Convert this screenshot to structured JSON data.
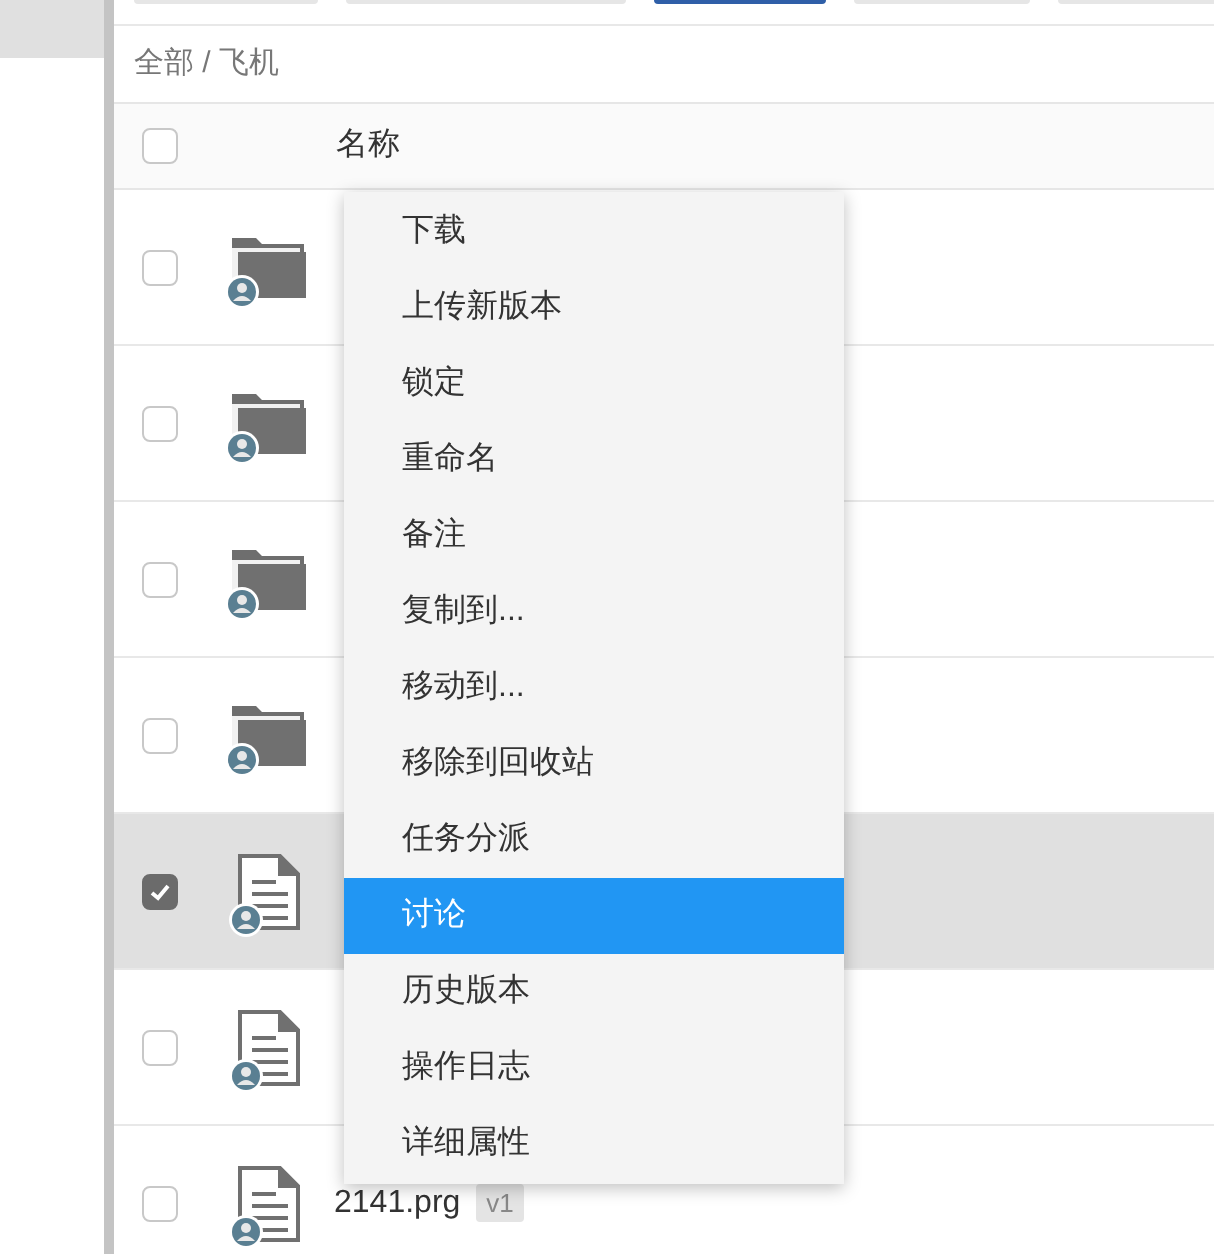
{
  "toolbar": [
    {
      "selected": false
    },
    {
      "selected": false
    },
    {
      "selected": true
    },
    {
      "selected": false
    },
    {
      "selected": false
    }
  ],
  "breadcrumb": "全部 / 飞机",
  "table": {
    "header": {
      "checked": false,
      "name": "名称"
    },
    "rows": [
      {
        "kind": "folder",
        "checked": false,
        "selected": false
      },
      {
        "kind": "folder",
        "checked": false,
        "selected": false
      },
      {
        "kind": "folder",
        "checked": false,
        "selected": false
      },
      {
        "kind": "folder",
        "checked": false,
        "selected": false
      },
      {
        "kind": "file",
        "checked": true,
        "selected": true
      },
      {
        "kind": "file",
        "checked": false,
        "selected": false
      },
      {
        "kind": "file",
        "checked": false,
        "selected": false,
        "name": "2141.prg",
        "version": "v1"
      }
    ]
  },
  "context_menu": [
    {
      "label": "下载",
      "selected": false
    },
    {
      "label": "上传新版本",
      "selected": false
    },
    {
      "label": "锁定",
      "selected": false
    },
    {
      "label": "重命名",
      "selected": false
    },
    {
      "label": "备注",
      "selected": false
    },
    {
      "label": "复制到...",
      "selected": false
    },
    {
      "label": "移动到...",
      "selected": false
    },
    {
      "label": "移除到回收站",
      "selected": false
    },
    {
      "label": "任务分派",
      "selected": false
    },
    {
      "label": "讨论",
      "selected": true
    },
    {
      "label": "历史版本",
      "selected": false
    },
    {
      "label": "操作日志",
      "selected": false
    },
    {
      "label": "详细属性",
      "selected": false
    }
  ]
}
